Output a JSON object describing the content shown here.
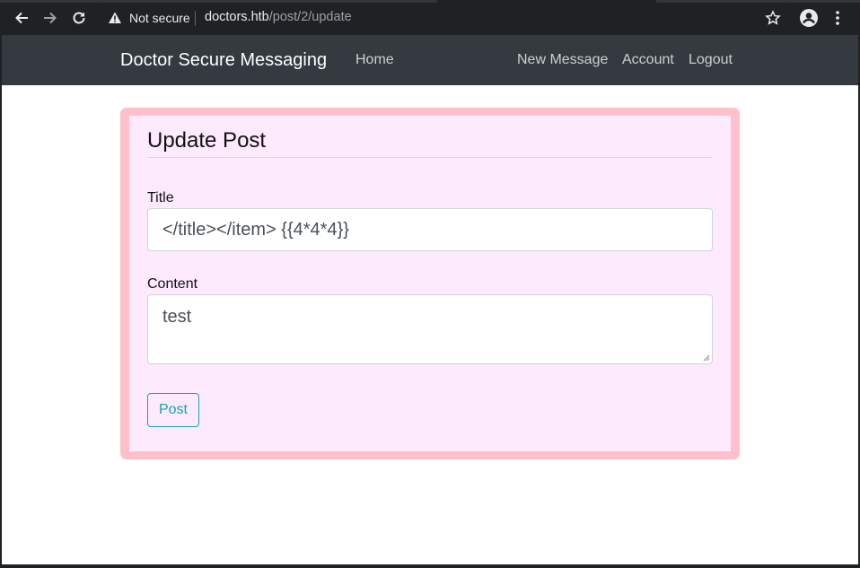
{
  "browser": {
    "security_label": "Not secure",
    "url_host": "doctors.htb",
    "url_path": "/post/2/update"
  },
  "navbar": {
    "brand": "Doctor Secure Messaging",
    "home": "Home",
    "new_message": "New Message",
    "account": "Account",
    "logout": "Logout",
    "background": "#343a40"
  },
  "form": {
    "legend": "Update Post",
    "title_label": "Title",
    "title_value": "</title></item> {{4*4*4}}",
    "content_label": "Content",
    "content_value": "test",
    "submit_label": "Post",
    "card_border_color": "#ffc0cb",
    "card_background": "#fdeafd",
    "button_color": "#17a2b8"
  },
  "icons": [
    "back-arrow-icon",
    "forward-arrow-icon",
    "reload-icon",
    "warning-triangle-icon",
    "star-icon",
    "account-icon",
    "kebab-menu-icon"
  ]
}
